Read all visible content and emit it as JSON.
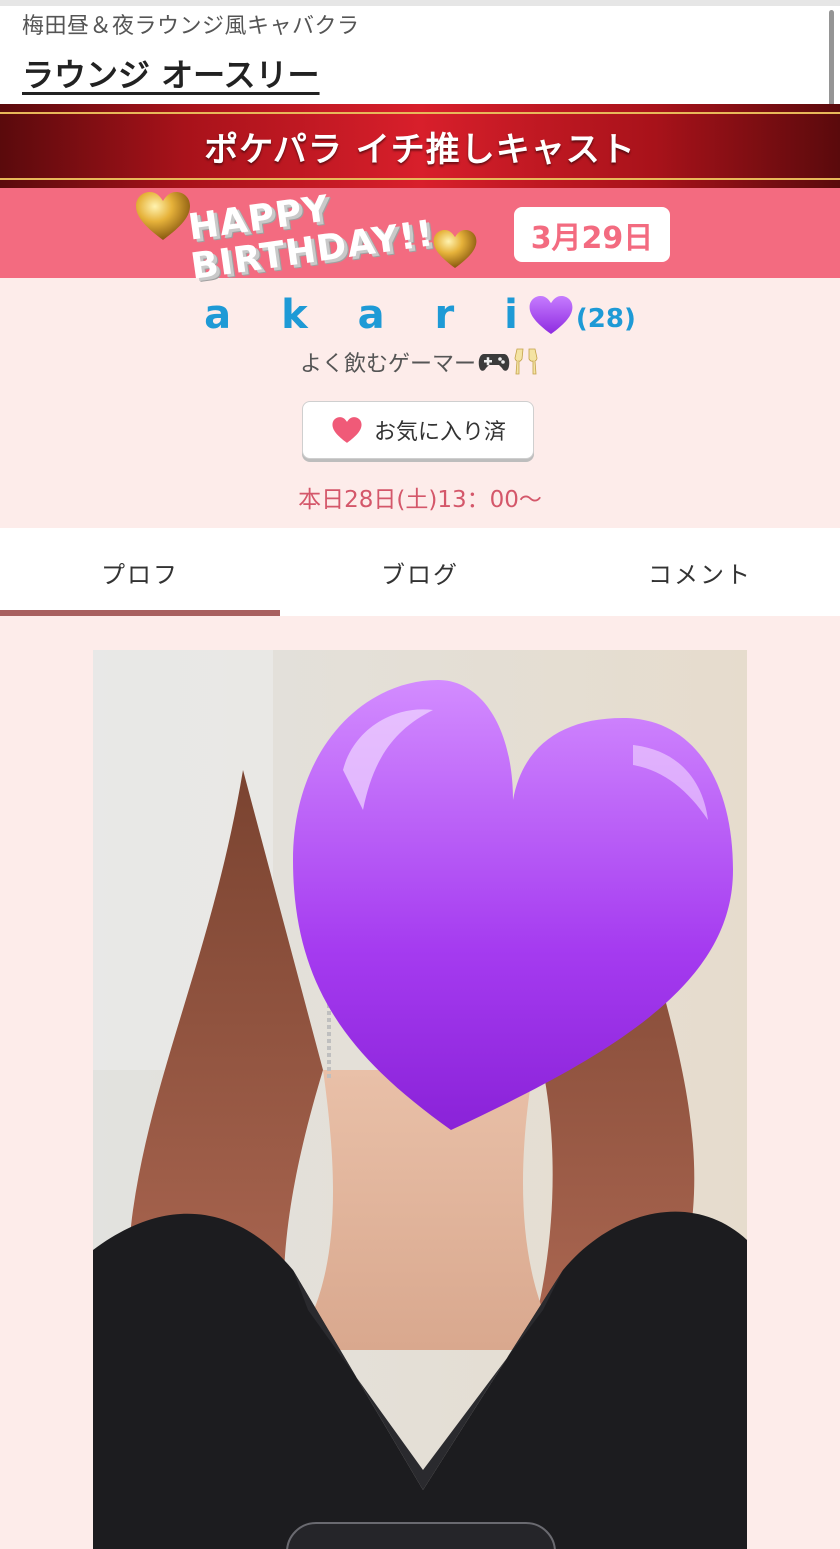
{
  "header": {
    "subtitle": "梅田昼＆夜ラウンジ風キャバクラ",
    "shop_name": "ラウンジ オースリー"
  },
  "banner": {
    "text": "ポケパラ イチ推しキャスト",
    "colors": {
      "primary": "#d81f2b",
      "trim": "#e8b85a"
    }
  },
  "birthday": {
    "line1": "HAPPY",
    "line2": "BIRTHDAY!!",
    "date": "3月29日",
    "strip_color": "#f36b80"
  },
  "cast": {
    "name": "a k a r i",
    "age": "(28)",
    "catchphrase": "よく飲むゲーマー",
    "catch_icons": [
      "game-controller-icon",
      "champagne-icon"
    ],
    "name_color": "#1e9ad6"
  },
  "favorite_button": {
    "label": "お気に入り済",
    "icon": "heart-icon"
  },
  "schedule": "本日28日(土)13：00〜",
  "tabs": [
    {
      "label": "プロフ",
      "active": true
    },
    {
      "label": "ブログ",
      "active": false
    },
    {
      "label": "コメント",
      "active": false
    }
  ]
}
